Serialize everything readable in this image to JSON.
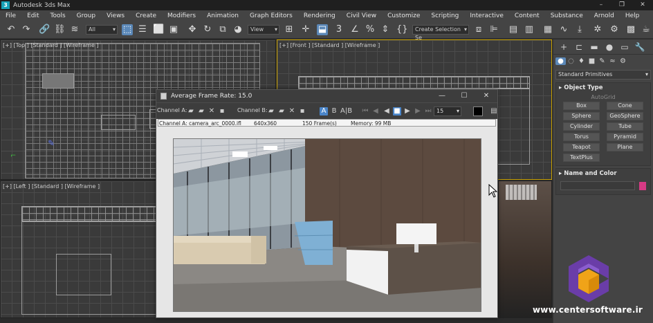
{
  "app": {
    "title": "Autodesk 3ds Max",
    "logo_letter": "3",
    "window_controls": [
      "–",
      "❐",
      "✕"
    ]
  },
  "menu": [
    "File",
    "Edit",
    "Tools",
    "Group",
    "Views",
    "Create",
    "Modifiers",
    "Animation",
    "Graph Editors",
    "Rendering",
    "Civil View",
    "Customize",
    "Scripting",
    "Interactive",
    "Content",
    "Substance",
    "Arnold",
    "Help"
  ],
  "toolbar": {
    "filter_dropdown": "All",
    "reference_coord_dropdown": "View",
    "selection_set_dropdown": "Create Selection Se",
    "icons": [
      "undo-icon",
      "redo-icon",
      "link-icon",
      "unlink-icon",
      "bind-spacewarp-icon",
      "select-object-icon",
      "select-by-name-icon",
      "rect-selection-icon",
      "window-crossing-icon",
      "move-icon",
      "rotate-icon",
      "scale-icon",
      "placement-icon",
      "pivot-icon",
      "snaps-icon",
      "angle-snap-icon",
      "percent-snap-icon",
      "spinner-snap-icon",
      "mirror-icon",
      "align-icon",
      "scene-explorer-icon",
      "layer-explorer-icon",
      "ribbon-icon",
      "curve-editor-icon",
      "schematic-view-icon",
      "material-editor-icon",
      "render-setup-icon",
      "rendered-frame-window-icon",
      "render-production-icon"
    ]
  },
  "viewports": {
    "top": "[+] [Top ] [Standard ] [Wireframe ]",
    "front": "[+] [Front ] [Standard ] [Wireframe ]",
    "left": "[+] [Left ] [Standard ] [Wireframe ]"
  },
  "command_panel": {
    "tabs": [
      "+",
      "⊏",
      "▬",
      "●",
      "▭",
      "🔧"
    ],
    "sub_icons": [
      "geometry-icon",
      "shapes-icon",
      "lights-icon",
      "cameras-icon",
      "helpers-icon",
      "spacewarps-icon",
      "systems-icon"
    ],
    "category_dropdown": "Standard Primitives",
    "object_type": {
      "header": "Object Type",
      "autogrid": "AutoGrid",
      "buttons": [
        "Box",
        "Cone",
        "Sphere",
        "GeoSphere",
        "Cylinder",
        "Tube",
        "Torus",
        "Pyramid",
        "Teapot",
        "Plane",
        "TextPlus"
      ]
    },
    "name_and_color": {
      "header": "Name and Color",
      "name_value": "",
      "color": "#d63a84"
    }
  },
  "frame_buffer": {
    "title": "Average Frame Rate: 15.0",
    "channel_a_label": "Channel A:",
    "channel_b_label": "Channel B:",
    "frame_rate_value": "15",
    "status": {
      "channel": "Channel A: camera_arc_0000.ifl",
      "resolution": "640x360",
      "frames": "150 Frame(s)",
      "memory": "Memory: 99 MB"
    },
    "window_controls": [
      "—",
      "☐",
      "✕"
    ]
  },
  "watermark": "www.centersoftware.ir",
  "colors": {
    "accent": "#5b88b8",
    "panel": "#444444",
    "viewport": "#3a3a3a"
  }
}
